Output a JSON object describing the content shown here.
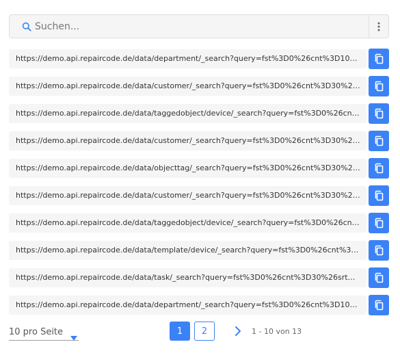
{
  "search": {
    "placeholder": "Suchen..."
  },
  "icons": {
    "search": "search-icon",
    "menu": "more-vertical-icon",
    "copy": "copy-icon",
    "dropdown": "caret-down-icon",
    "next": "chevron-right-icon"
  },
  "colors": {
    "accent": "#3b82f6",
    "row_background": "#f5f5f5"
  },
  "urls": [
    "https://demo.api.repaircode.de/data/department/_search?query=fst%3D0%26cnt%3D10%2...",
    "https://demo.api.repaircode.de/data/customer/_search?query=fst%3D0%26cnt%3D30%26s...",
    "https://demo.api.repaircode.de/data/taggedobject/device/_search?query=fst%3D0%26cnt...",
    "https://demo.api.repaircode.de/data/customer/_search?query=fst%3D0%26cnt%3D30%26s...",
    "https://demo.api.repaircode.de/data/objecttag/_search?query=fst%3D0%26cnt%3D30%26s...",
    "https://demo.api.repaircode.de/data/customer/_search?query=fst%3D0%26cnt%3D30%26s...",
    "https://demo.api.repaircode.de/data/taggedobject/device/_search?query=fst%3D0%26cnt...",
    "https://demo.api.repaircode.de/data/template/device/_search?query=fst%3D0%26cnt%3D...",
    "https://demo.api.repaircode.de/data/task/_search?query=fst%3D0%26cnt%3D30%26srt%3...",
    "https://demo.api.repaircode.de/data/department/_search?query=fst%3D0%26cnt%3D100..."
  ],
  "pagination": {
    "per_page_label": "10 pro Seite",
    "pages": [
      "1",
      "2"
    ],
    "current_page": "1",
    "range_label": "1 - 10 von 13"
  }
}
